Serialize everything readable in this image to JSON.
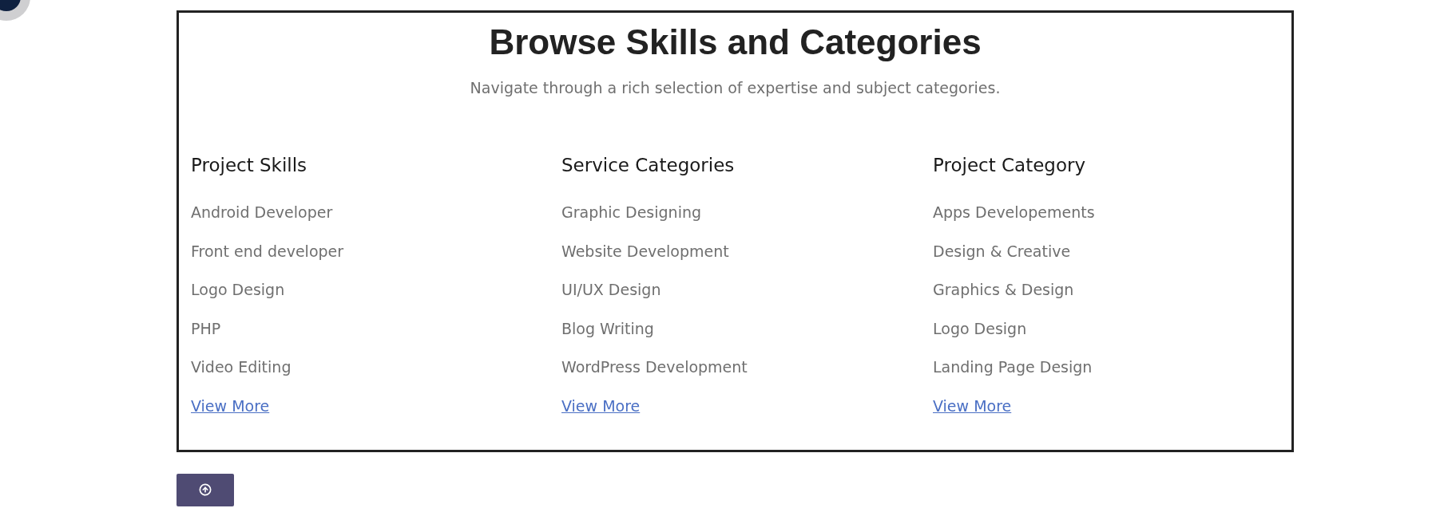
{
  "title": "Browse Skills and Categories",
  "subtitle": "Navigate through a rich selection of expertise and subject categories.",
  "columns": [
    {
      "heading": "Project Skills",
      "items": [
        "Android Developer",
        "Front end developer",
        "Logo Design",
        "PHP",
        "Video Editing"
      ],
      "link": "View More"
    },
    {
      "heading": "Service Categories",
      "items": [
        "Graphic Designing",
        "Website Development",
        "UI/UX Design",
        "Blog Writing",
        "WordPress Development"
      ],
      "link": "View More"
    },
    {
      "heading": "Project Category",
      "items": [
        "Apps Developements",
        "Design & Creative",
        "Graphics & Design",
        "Logo Design",
        "Landing Page Design"
      ],
      "link": "View More"
    }
  ]
}
